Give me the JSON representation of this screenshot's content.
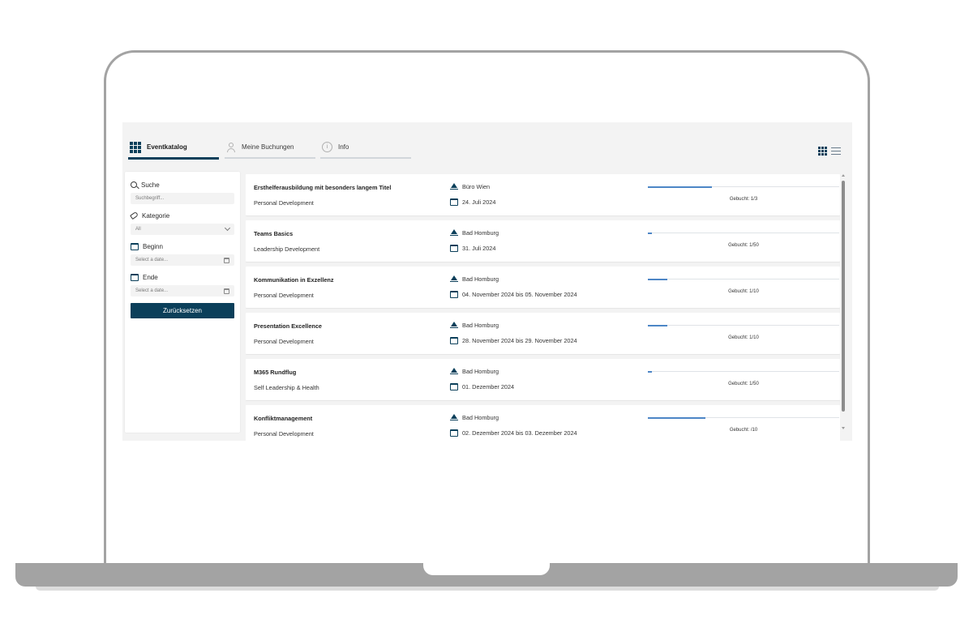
{
  "tabs": [
    {
      "label": "Eventkatalog",
      "icon": "grid-icon"
    },
    {
      "label": "Meine Buchungen",
      "icon": "person-icon"
    },
    {
      "label": "Info",
      "icon": "info-icon"
    }
  ],
  "view_toggles": {
    "grid": "grid-view-icon",
    "list": "list-view-icon"
  },
  "filters": {
    "search_label": "Suche",
    "search_placeholder": "Suchbegriff...",
    "category_label": "Kategorie",
    "category_value": "All",
    "begin_label": "Beginn",
    "begin_placeholder": "Select a date...",
    "end_label": "Ende",
    "end_placeholder": "Select a date...",
    "reset_label": "Zurücksetzen"
  },
  "colors": {
    "primary": "#0b3f5a",
    "progress": "#4d86c6",
    "background": "#f3f3f3"
  },
  "events": [
    {
      "title": "Ersthelferausbildung mit besonders langem Titel",
      "category": "Personal Development",
      "location": "Büro Wien",
      "date": "24. Juli 2024",
      "booked_label": "Gebucht: 1/3",
      "fill_fraction": 0.333
    },
    {
      "title": "Teams Basics",
      "category": "Leadership Development",
      "location": "Bad Homburg",
      "date": "31. Juli 2024",
      "booked_label": "Gebucht: 1/50",
      "fill_fraction": 0.02
    },
    {
      "title": "Kommunikation in Exzellenz",
      "category": "Personal Development",
      "location": "Bad Homburg",
      "date": "04. November 2024 bis 05. November 2024",
      "booked_label": "Gebucht: 1/10",
      "fill_fraction": 0.1
    },
    {
      "title": "Presentation Excellence",
      "category": "Personal Development",
      "location": "Bad Homburg",
      "date": "28. November 2024 bis 29. November 2024",
      "booked_label": "Gebucht: 1/10",
      "fill_fraction": 0.1
    },
    {
      "title": "M365 Rundflug",
      "category": "Self Leadership & Health",
      "location": "Bad Homburg",
      "date": "01. Dezember 2024",
      "booked_label": "Gebucht: 1/50",
      "fill_fraction": 0.02
    },
    {
      "title": "Konfliktmanagement",
      "category": "Personal Development",
      "location": "Bad Homburg",
      "date": "02. Dezember 2024 bis 03. Dezember 2024",
      "booked_label": "Gebucht: /10",
      "fill_fraction": 0.3
    }
  ]
}
